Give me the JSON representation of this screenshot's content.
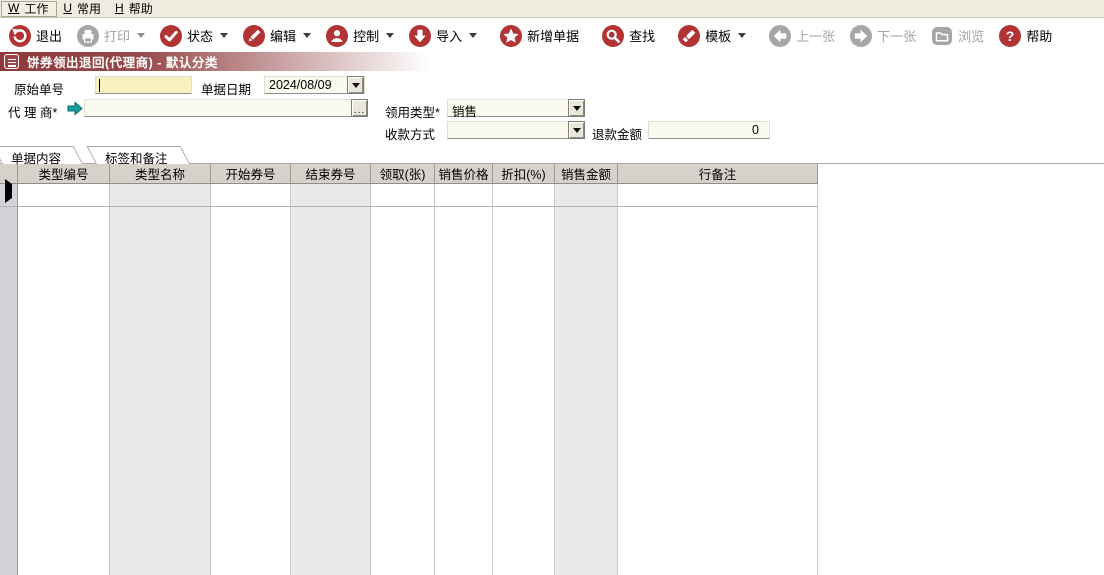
{
  "menu": {
    "items": [
      {
        "mnemonic": "W",
        "label": "工作"
      },
      {
        "mnemonic": "U",
        "label": "常用"
      },
      {
        "mnemonic": "H",
        "label": "帮助"
      }
    ]
  },
  "toolbar": {
    "buttons": [
      {
        "label": "退出",
        "icon": "exit-icon",
        "enabled": true,
        "dropdown": false
      },
      {
        "label": "打印",
        "icon": "print-icon",
        "enabled": false,
        "dropdown": true
      },
      {
        "label": "状态",
        "icon": "status-icon",
        "enabled": true,
        "dropdown": true
      },
      {
        "label": "编辑",
        "icon": "edit-icon",
        "enabled": true,
        "dropdown": true
      },
      {
        "label": "控制",
        "icon": "control-icon",
        "enabled": true,
        "dropdown": true
      },
      {
        "label": "导入",
        "icon": "import-icon",
        "enabled": true,
        "dropdown": true
      },
      {
        "label": "新增单据",
        "icon": "new-doc-icon",
        "enabled": true,
        "dropdown": false
      },
      {
        "label": "查找",
        "icon": "search-icon",
        "enabled": true,
        "dropdown": false
      },
      {
        "label": "模板",
        "icon": "template-icon",
        "enabled": true,
        "dropdown": true
      },
      {
        "label": "上一张",
        "icon": "prev-icon",
        "enabled": false,
        "dropdown": false
      },
      {
        "label": "下一张",
        "icon": "next-icon",
        "enabled": false,
        "dropdown": false
      },
      {
        "label": "浏览",
        "icon": "browse-icon",
        "enabled": false,
        "dropdown": false
      },
      {
        "label": "帮助",
        "icon": "help-icon",
        "enabled": true,
        "dropdown": false
      }
    ]
  },
  "titlebar": {
    "title": "饼券领出退回(代理商) - 默认分类"
  },
  "form": {
    "original_no": {
      "label": "原始单号",
      "value": ""
    },
    "doc_date": {
      "label": "单据日期",
      "value": "2024/08/09"
    },
    "agent": {
      "label": "代 理 商*",
      "value": ""
    },
    "usage_type": {
      "label": "领用类型*",
      "value": "销售"
    },
    "payment_method": {
      "label": "收款方式",
      "value": ""
    },
    "refund_amount": {
      "label": "退款金额",
      "value": "0"
    }
  },
  "tabs": [
    {
      "label": "单据内容",
      "active": true
    },
    {
      "label": "标签和备注",
      "active": false
    }
  ],
  "grid": {
    "columns": [
      "类型编号",
      "类型名称",
      "开始券号",
      "结束券号",
      "领取(张)",
      "销售价格",
      "折扣(%)",
      "销售金额",
      "行备注"
    ],
    "rows": []
  },
  "colors": {
    "accent_red": "#b23333",
    "titlebar_red": "#8c3a3a",
    "disabled_gray": "#a6a6a6",
    "field_yellow": "#f7f2bd",
    "field_ivory": "#fbfaef",
    "grid_stripe": "#e9e9e9",
    "grid_header": "#d6d2cb",
    "row_selector": "#d3d2d9",
    "agent_arrow_teal": "#16a0a0"
  }
}
